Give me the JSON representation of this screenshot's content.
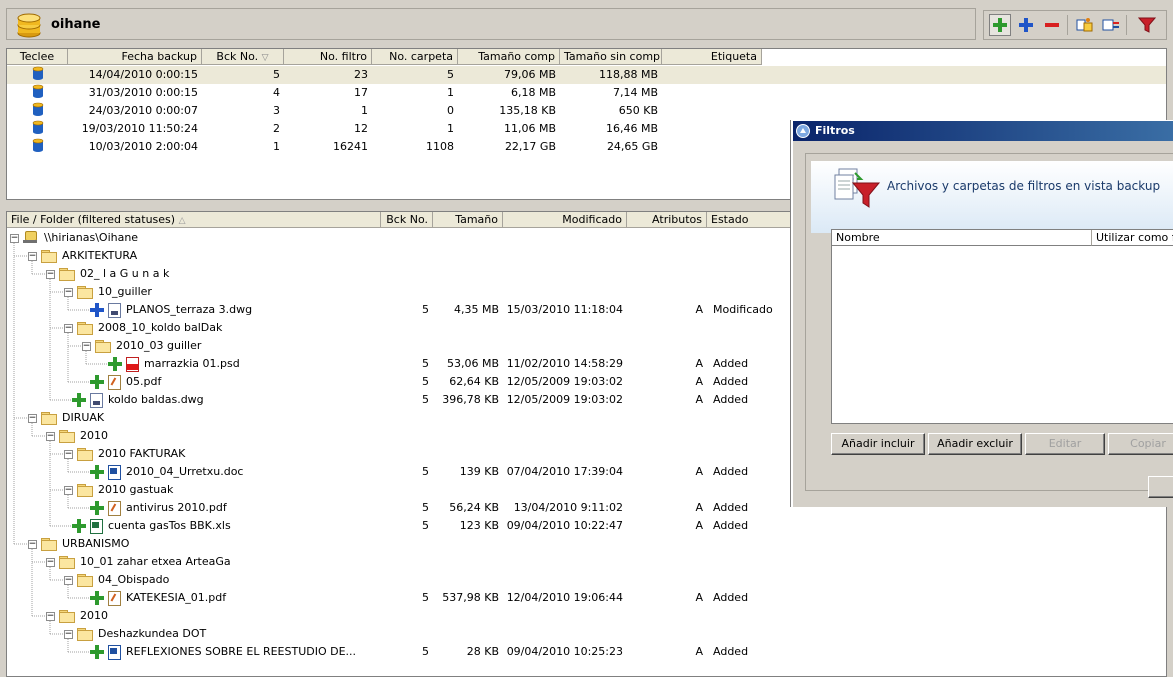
{
  "app": {
    "title": "oihane"
  },
  "toolbar": {
    "items": [
      "add-green",
      "add-blue",
      "remove",
      "restore",
      "edit",
      "filter"
    ]
  },
  "backups": {
    "columns": [
      "Teclee",
      "Fecha backup",
      "Bck No.",
      "No. filtro",
      "No. carpeta",
      "Tamaño comp",
      "Tamaño sin compr",
      "Etiqueta"
    ],
    "rows": [
      {
        "date": "14/04/2010 0:00:15",
        "bck": "5",
        "filtro": "23",
        "carpeta": "5",
        "comp": "79,06 MB",
        "sincomp": "118,88 MB",
        "etiqueta": ""
      },
      {
        "date": "31/03/2010 0:00:15",
        "bck": "4",
        "filtro": "17",
        "carpeta": "1",
        "comp": "6,18 MB",
        "sincomp": "7,14 MB",
        "etiqueta": ""
      },
      {
        "date": "24/03/2010 0:00:07",
        "bck": "3",
        "filtro": "1",
        "carpeta": "0",
        "comp": "135,18 KB",
        "sincomp": "650 KB",
        "etiqueta": ""
      },
      {
        "date": "19/03/2010 11:50:24",
        "bck": "2",
        "filtro": "12",
        "carpeta": "1",
        "comp": "11,06 MB",
        "sincomp": "16,46 MB",
        "etiqueta": ""
      },
      {
        "date": "10/03/2010 2:00:04",
        "bck": "1",
        "filtro": "16241",
        "carpeta": "1108",
        "comp": "22,17 GB",
        "sincomp": "24,65 GB",
        "etiqueta": ""
      }
    ]
  },
  "files": {
    "columns": [
      "File / Folder (filtered statuses)",
      "Bck No.",
      "Tamaño",
      "Modificado",
      "Atributos",
      "Estado"
    ],
    "rows": [
      {
        "level": 0,
        "type": "net",
        "name": "\\\\hirianas\\Oihane"
      },
      {
        "level": 1,
        "type": "folder",
        "name": "ARKITEKTURA"
      },
      {
        "level": 2,
        "type": "folder",
        "name": "02_ l a G u n a k"
      },
      {
        "level": 3,
        "type": "folder",
        "name": "10_guiller"
      },
      {
        "level": 4,
        "type": "file",
        "icon": "dwg",
        "status": "mod",
        "name": "PLANOS_terraza 3.dwg",
        "bck": "5",
        "size": "4,35 MB",
        "mod": "15/03/2010 11:18:04",
        "attr": "A",
        "estado": "Modificado"
      },
      {
        "level": 3,
        "type": "folder",
        "name": "2008_10_koldo balDak"
      },
      {
        "level": 4,
        "type": "folder",
        "name": "2010_03 guiller"
      },
      {
        "level": 5,
        "type": "file",
        "icon": "psd",
        "status": "add",
        "name": "marrazkia 01.psd",
        "bck": "5",
        "size": "53,06 MB",
        "mod": "11/02/2010 14:58:29",
        "attr": "A",
        "estado": "Added"
      },
      {
        "level": 4,
        "type": "file",
        "icon": "pdf",
        "status": "add",
        "name": "05.pdf",
        "bck": "5",
        "size": "62,64 KB",
        "mod": "12/05/2009 19:03:02",
        "attr": "A",
        "estado": "Added"
      },
      {
        "level": 3,
        "type": "file",
        "icon": "dwg",
        "status": "add",
        "name": "koldo baldas.dwg",
        "bck": "5",
        "size": "396,78 KB",
        "mod": "12/05/2009 19:03:02",
        "attr": "A",
        "estado": "Added"
      },
      {
        "level": 1,
        "type": "folder",
        "name": "DIRUAK"
      },
      {
        "level": 2,
        "type": "folder",
        "name": "2010"
      },
      {
        "level": 3,
        "type": "folder",
        "name": "2010 FAKTURAK"
      },
      {
        "level": 4,
        "type": "file",
        "icon": "doc",
        "status": "add",
        "name": "2010_04_Urretxu.doc",
        "bck": "5",
        "size": "139 KB",
        "mod": "07/04/2010 17:39:04",
        "attr": "A",
        "estado": "Added"
      },
      {
        "level": 3,
        "type": "folder",
        "name": "2010 gastuak"
      },
      {
        "level": 4,
        "type": "file",
        "icon": "pdf",
        "status": "add",
        "name": "antivirus 2010.pdf",
        "bck": "5",
        "size": "56,24 KB",
        "mod": "13/04/2010 9:11:02",
        "attr": "A",
        "estado": "Added"
      },
      {
        "level": 3,
        "type": "file",
        "icon": "xls",
        "status": "add",
        "name": "cuenta gasTos BBK.xls",
        "bck": "5",
        "size": "123 KB",
        "mod": "09/04/2010 10:22:47",
        "attr": "A",
        "estado": "Added"
      },
      {
        "level": 1,
        "type": "folder",
        "name": "URBANISMO"
      },
      {
        "level": 2,
        "type": "folder",
        "name": "10_01 zahar etxea ArteaGa"
      },
      {
        "level": 3,
        "type": "folder",
        "name": "04_Obispado"
      },
      {
        "level": 4,
        "type": "file",
        "icon": "pdf",
        "status": "add",
        "name": "KATEKESIA_01.pdf",
        "bck": "5",
        "size": "537,98 KB",
        "mod": "12/04/2010 19:06:44",
        "attr": "A",
        "estado": "Added"
      },
      {
        "level": 2,
        "type": "folder",
        "name": "2010"
      },
      {
        "level": 3,
        "type": "folder",
        "name": "Deshazkundea  DOT"
      },
      {
        "level": 4,
        "type": "file",
        "icon": "doc",
        "status": "add",
        "name": "REFLEXIONES SOBRE EL REESTUDIO DE...",
        "bck": "5",
        "size": "28 KB",
        "mod": "09/04/2010 10:25:23",
        "attr": "A",
        "estado": "Added"
      }
    ]
  },
  "filtros": {
    "title": "Filtros",
    "heading": "Archivos y carpetas de filtros en vista backup",
    "columns": [
      "Nombre",
      "Utilizar como filtro"
    ],
    "buttons": {
      "add_include": "Añadir incluir",
      "add_exclude": "Añadir excluir",
      "edit": "Editar",
      "copy": "Copiar"
    }
  }
}
